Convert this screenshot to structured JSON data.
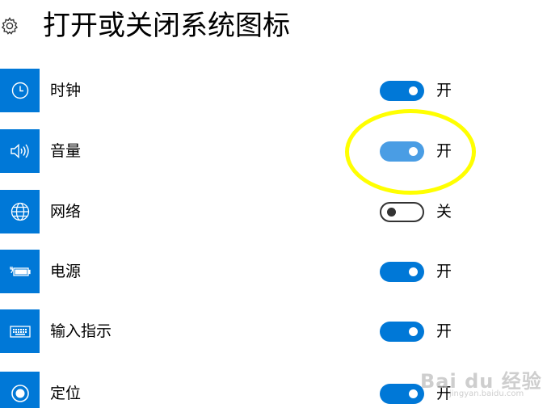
{
  "header": {
    "title": "打开或关闭系统图标",
    "icon": "gear-icon"
  },
  "colors": {
    "accent": "#0078d7",
    "highlight": "#ffff00"
  },
  "items": [
    {
      "id": "clock",
      "label": "时钟",
      "icon": "clock-icon",
      "state": "开",
      "on": true
    },
    {
      "id": "volume",
      "label": "音量",
      "icon": "speaker-icon",
      "state": "开",
      "on": true
    },
    {
      "id": "network",
      "label": "网络",
      "icon": "globe-icon",
      "state": "关",
      "on": false
    },
    {
      "id": "power",
      "label": "电源",
      "icon": "battery-plug-icon",
      "state": "开",
      "on": true
    },
    {
      "id": "input",
      "label": "输入指示",
      "icon": "keyboard-icon",
      "state": "开",
      "on": true
    },
    {
      "id": "location",
      "label": "定位",
      "icon": "location-icon",
      "state": "开",
      "on": true
    }
  ],
  "watermark": {
    "text": "Bai du 经验",
    "url": "jingyan.baidu.com"
  }
}
